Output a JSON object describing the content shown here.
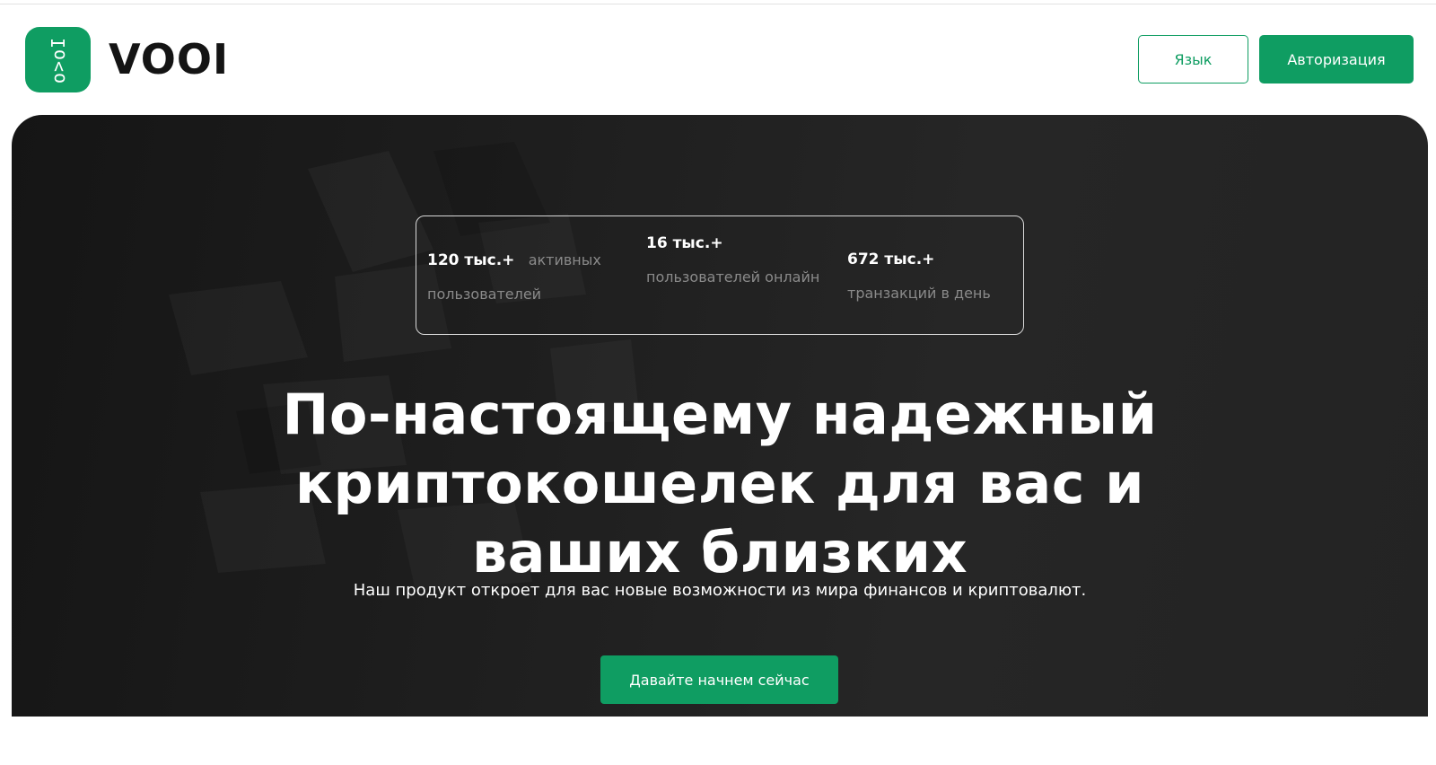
{
  "brand": {
    "logo_glyphs": "o>oI",
    "name": "VOOI"
  },
  "header": {
    "language_label": "Язык",
    "auth_label": "Авторизация"
  },
  "stats": [
    {
      "value": "120 тыс.+",
      "label": "активных пользователей"
    },
    {
      "value": "16 тыс.+",
      "label": "пользователей онлайн"
    },
    {
      "value": "672 тыс.+",
      "label": "транзакций в день"
    }
  ],
  "hero": {
    "title_lines": [
      "По-настоящему надежный",
      "криптокошелек для вас и",
      "ваших близких"
    ],
    "subtitle": "Наш продукт откроет для вас новые возможности из мира финансов и криптовалют.",
    "cta_label": "Давайте начнем сейчас"
  },
  "colors": {
    "accent": "#0f9d62",
    "hero_background": "#1e1e1e",
    "text_dark": "#141414",
    "muted_text": "#8a8a8a"
  }
}
